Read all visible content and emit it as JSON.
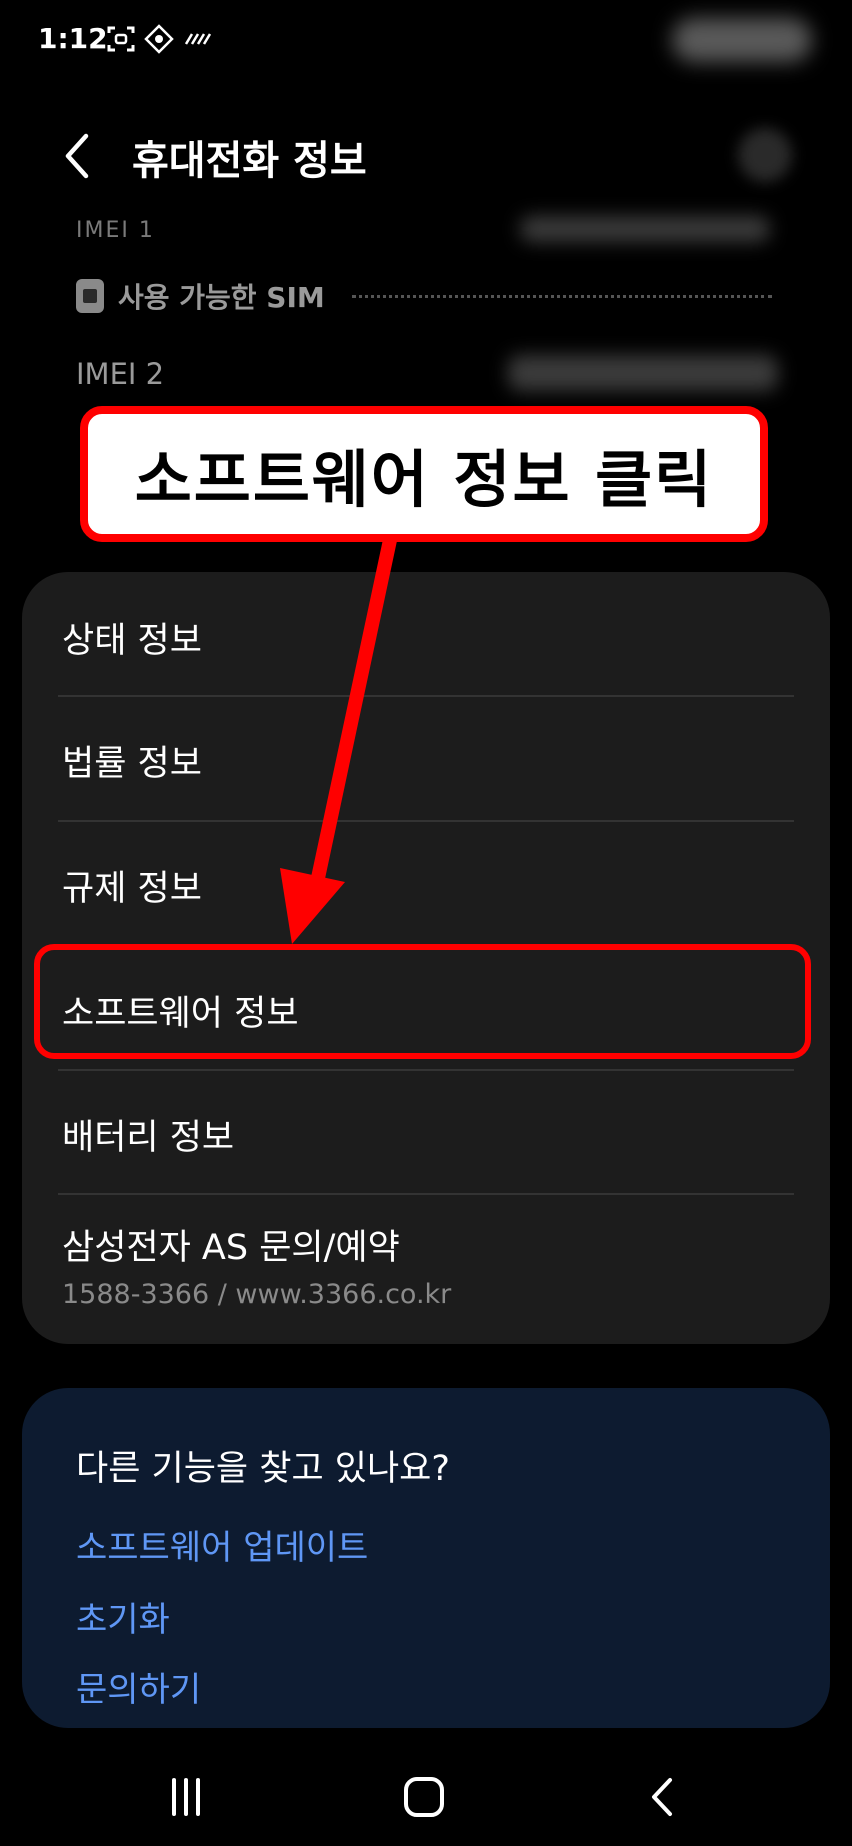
{
  "status_bar": {
    "time": "1:12"
  },
  "header": {
    "title": "휴대전화 정보",
    "back_icon": "chevron-left-icon",
    "search_icon": "search-icon"
  },
  "top_info": {
    "imei1_partial": "IMEI 1",
    "sim_label": "사용 가능한 SIM",
    "imei2_label": "IMEI 2"
  },
  "callout": {
    "text": "소프트웨어 정보 클릭"
  },
  "menu": {
    "items": [
      {
        "label": "상태 정보"
      },
      {
        "label": "법률 정보"
      },
      {
        "label": "규제 정보"
      },
      {
        "label": "소프트웨어 정보"
      },
      {
        "label": "배터리 정보"
      },
      {
        "label": "삼성전자 AS 문의/예약",
        "sub": "1588-3366 / www.3366.co.kr"
      }
    ]
  },
  "suggest": {
    "title": "다른 기능을 찾고 있나요?",
    "links": [
      "소프트웨어 업데이트",
      "초기화",
      "문의하기"
    ]
  },
  "nav": {
    "recents_icon": "recents-icon",
    "home_icon": "home-icon",
    "back_icon": "back-icon"
  },
  "colors": {
    "background": "#000000",
    "card": "#1c1c1c",
    "suggest_card": "#0d1b30",
    "link": "#5f97f5",
    "annotation": "#ff0000"
  }
}
